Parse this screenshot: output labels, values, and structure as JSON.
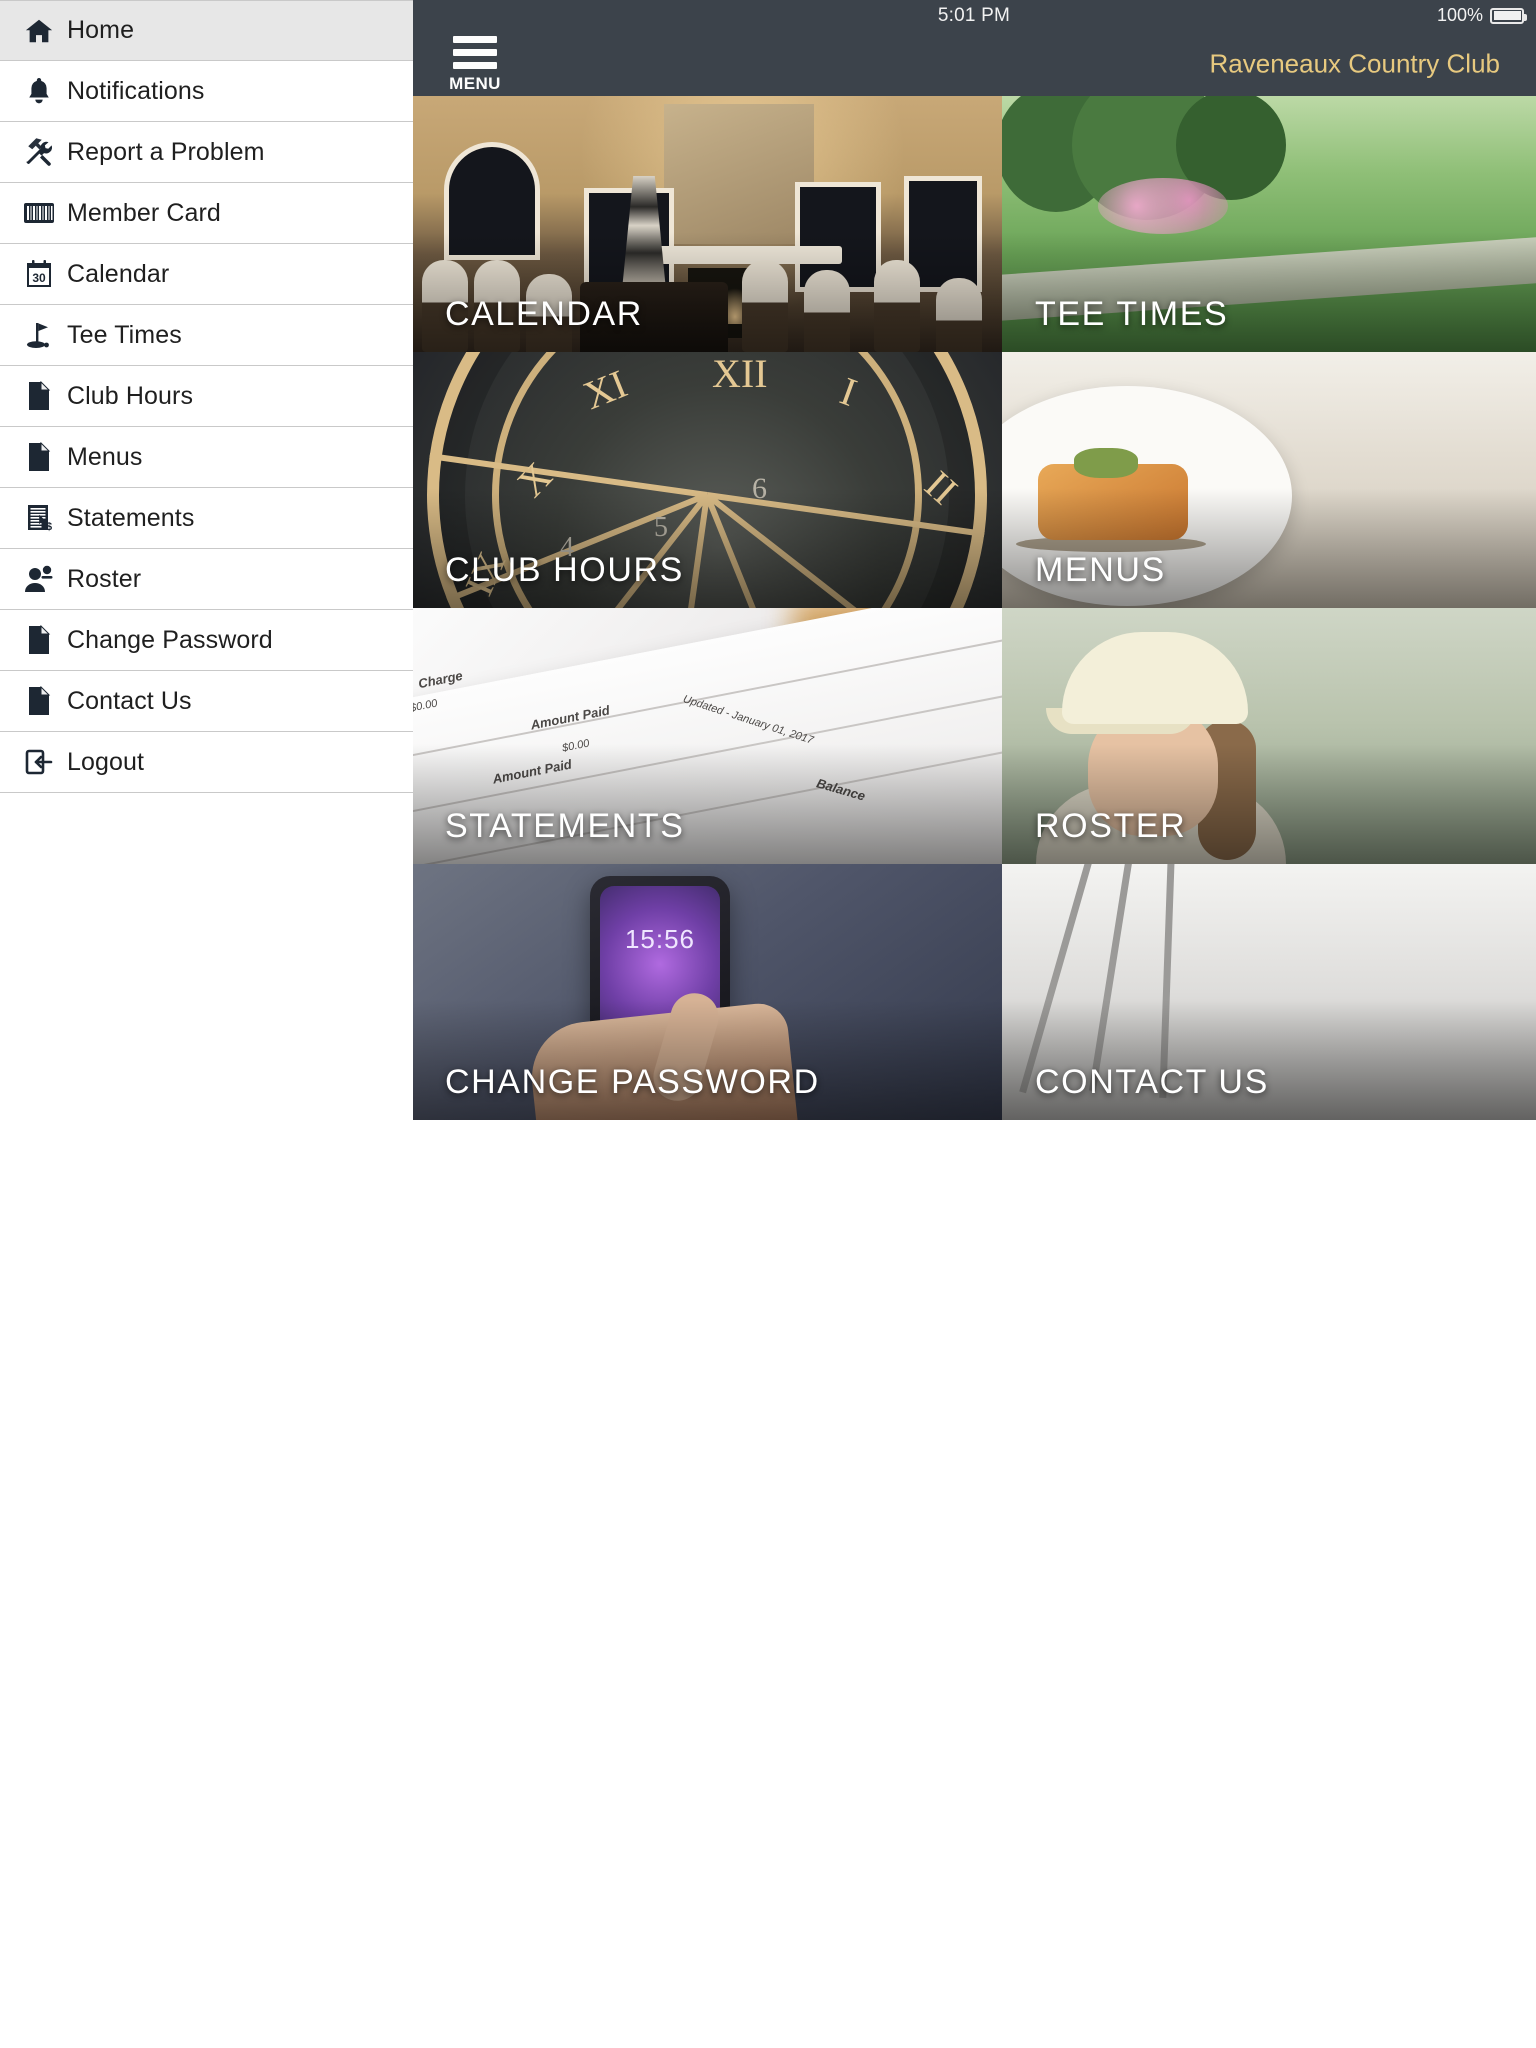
{
  "status_bar": {
    "time": "5:01 PM",
    "battery_percent": "100%",
    "battery_icon": "battery-full-icon"
  },
  "navbar": {
    "menu_icon": "hamburger-menu-icon",
    "menu_label": "MENU",
    "title": "Raveneaux Country Club",
    "title_color": "#e7c97f",
    "background_color": "#3c434b"
  },
  "drawer": {
    "items": [
      {
        "label": "Home",
        "icon": "home-icon",
        "active": true
      },
      {
        "label": "Notifications",
        "icon": "bell-icon",
        "active": false
      },
      {
        "label": "Report a Problem",
        "icon": "tools-icon",
        "active": false
      },
      {
        "label": "Member Card",
        "icon": "barcode-icon",
        "active": false
      },
      {
        "label": "Calendar",
        "icon": "calendar-30-icon",
        "active": false
      },
      {
        "label": "Tee Times",
        "icon": "golf-flag-icon",
        "active": false
      },
      {
        "label": "Club Hours",
        "icon": "document-icon",
        "active": false
      },
      {
        "label": "Menus",
        "icon": "document-icon",
        "active": false
      },
      {
        "label": "Statements",
        "icon": "invoice-dollar-icon",
        "active": false
      },
      {
        "label": "Roster",
        "icon": "person-add-icon",
        "active": false
      },
      {
        "label": "Change Password",
        "icon": "document-icon",
        "active": false
      },
      {
        "label": "Contact Us",
        "icon": "document-icon",
        "active": false
      },
      {
        "label": "Logout",
        "icon": "logout-icon",
        "active": false
      }
    ]
  },
  "tiles": [
    {
      "label": "CALENDAR",
      "art": "art-calendar",
      "image_subject": "banquet hall with wedding cake and fireplace"
    },
    {
      "label": "TEE TIMES",
      "art": "art-tee",
      "image_subject": "golf course with trees and flowering shrubs"
    },
    {
      "label": "CLUB HOURS",
      "art": "art-hours",
      "image_subject": "ornate gold roman numeral clock face"
    },
    {
      "label": "MENUS",
      "art": "art-menus",
      "image_subject": "plated gourmet entree"
    },
    {
      "label": "STATEMENTS",
      "art": "art-stmt",
      "image_subject": "printed billing statement paper"
    },
    {
      "label": "ROSTER",
      "art": "art-roster",
      "image_subject": "golfer wearing a visor cap"
    },
    {
      "label": "CHANGE PASSWORD",
      "art": "art-pwd",
      "image_subject": "hand holding smartphone with purple screen"
    },
    {
      "label": "CONTACT US",
      "art": "art-contact",
      "image_subject": "metal utensils on light background"
    }
  ],
  "statement_art_text": {
    "charge": "Charge",
    "amount_paid": "Amount Paid",
    "amount_paid_2": "Amount Paid",
    "value_top": "$0.00",
    "value_mid": "$0.00",
    "updated": "Updated - January 01, 2017",
    "balance": "Balance"
  },
  "phone_art_text": {
    "time": "15:56"
  }
}
